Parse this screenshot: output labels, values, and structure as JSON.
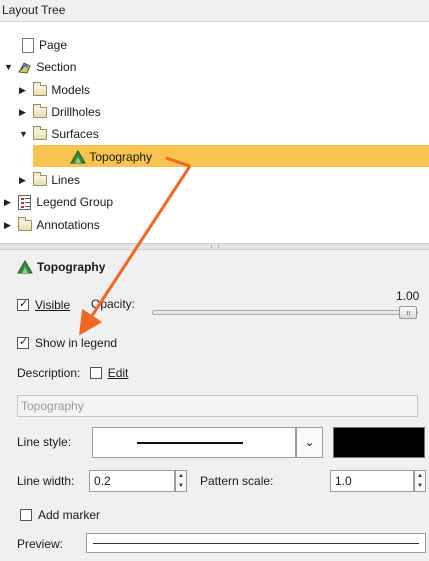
{
  "tree": {
    "header": "Layout Tree",
    "items": [
      {
        "label": "Page"
      },
      {
        "label": "Section"
      },
      {
        "label": "Models"
      },
      {
        "label": "Drillholes"
      },
      {
        "label": "Surfaces"
      },
      {
        "label": "Topography"
      },
      {
        "label": "Lines"
      },
      {
        "label": "Legend Group"
      },
      {
        "label": "Annotations"
      }
    ]
  },
  "props": {
    "title": "Topography",
    "visible_label": "Visible",
    "visible_checked": true,
    "opacity_label": "Opacity:",
    "opacity_value": "1.00",
    "opacity_level": 1.0,
    "show_in_legend_label": "Show in legend",
    "show_in_legend_checked": true,
    "description_label": "Description:",
    "edit_label": "Edit",
    "edit_checked": false,
    "description_value": "Topography",
    "line_style_label": "Line style:",
    "line_style_value": "solid",
    "line_color": "#000000",
    "line_width_label": "Line width:",
    "line_width_value": "0.2",
    "pattern_scale_label": "Pattern scale:",
    "pattern_scale_value": "1.0",
    "add_marker_label": "Add marker",
    "add_marker_checked": false,
    "preview_label": "Preview:"
  },
  "colors": {
    "selection": "#f8c24e",
    "annotation_arrow": "#f26522",
    "topography_icon": "#3a8a3a"
  }
}
